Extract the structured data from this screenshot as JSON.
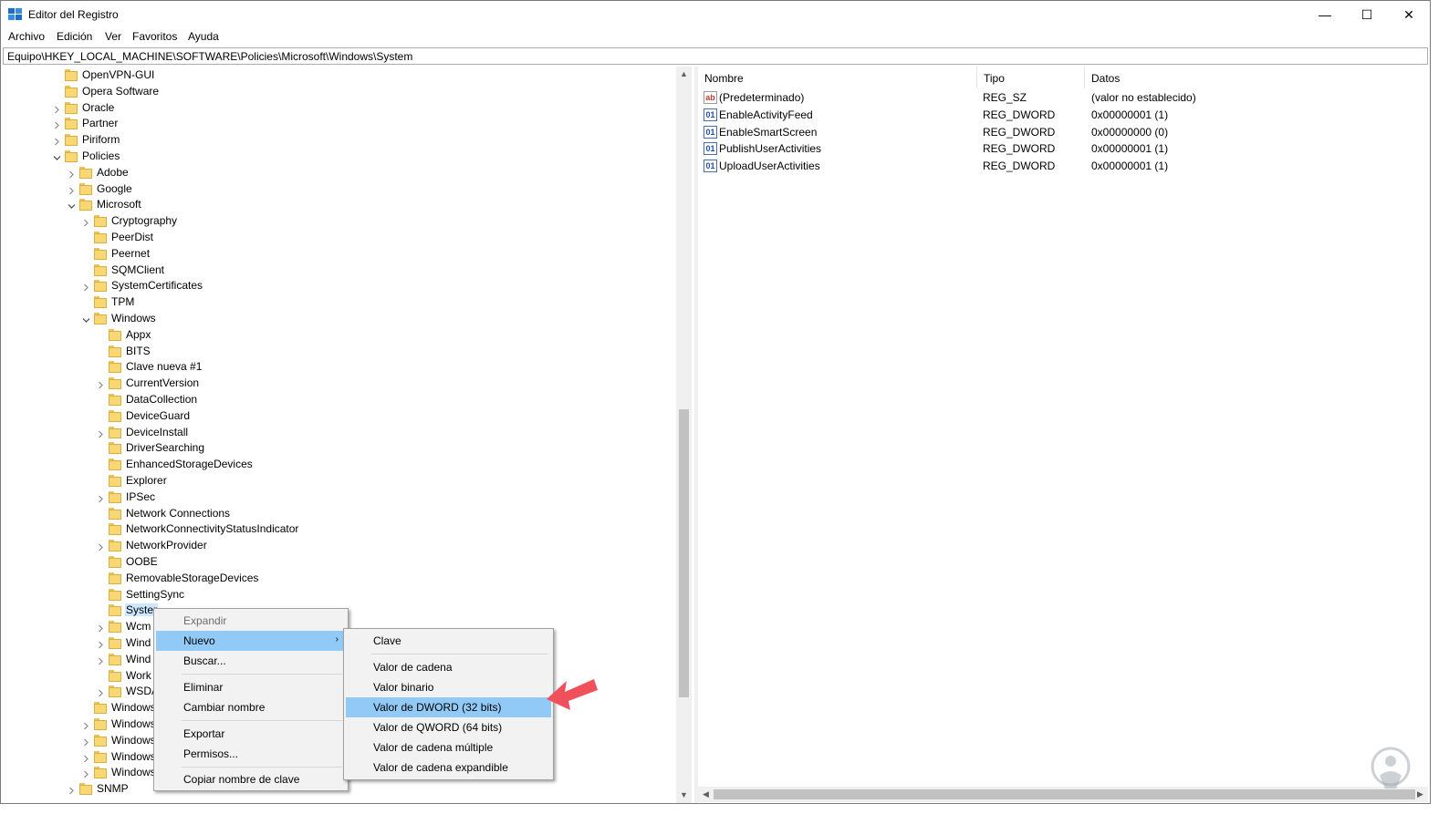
{
  "window": {
    "title": "Editor del Registro",
    "controls": {
      "minimize": "—",
      "maximize": "☐",
      "close": "✕"
    }
  },
  "menubar": [
    "Archivo",
    "Edición",
    "Ver",
    "Favoritos",
    "Ayuda"
  ],
  "address": "Equipo\\HKEY_LOCAL_MACHINE\\SOFTWARE\\Policies\\Microsoft\\Windows\\System",
  "tree": [
    {
      "label": "OpenVPN-GUI",
      "depth": 0,
      "expander": "none"
    },
    {
      "label": "Opera Software",
      "depth": 0,
      "expander": "none"
    },
    {
      "label": "Oracle",
      "depth": 0,
      "expander": "collapsed"
    },
    {
      "label": "Partner",
      "depth": 0,
      "expander": "collapsed"
    },
    {
      "label": "Piriform",
      "depth": 0,
      "expander": "collapsed"
    },
    {
      "label": "Policies",
      "depth": 0,
      "expander": "expanded"
    },
    {
      "label": "Adobe",
      "depth": 1,
      "expander": "collapsed"
    },
    {
      "label": "Google",
      "depth": 1,
      "expander": "collapsed"
    },
    {
      "label": "Microsoft",
      "depth": 1,
      "expander": "expanded"
    },
    {
      "label": "Cryptography",
      "depth": 2,
      "expander": "collapsed"
    },
    {
      "label": "PeerDist",
      "depth": 2,
      "expander": "none"
    },
    {
      "label": "Peernet",
      "depth": 2,
      "expander": "none"
    },
    {
      "label": "SQMClient",
      "depth": 2,
      "expander": "none"
    },
    {
      "label": "SystemCertificates",
      "depth": 2,
      "expander": "collapsed"
    },
    {
      "label": "TPM",
      "depth": 2,
      "expander": "none"
    },
    {
      "label": "Windows",
      "depth": 2,
      "expander": "expanded"
    },
    {
      "label": "Appx",
      "depth": 3,
      "expander": "none"
    },
    {
      "label": "BITS",
      "depth": 3,
      "expander": "none"
    },
    {
      "label": "Clave nueva #1",
      "depth": 3,
      "expander": "none"
    },
    {
      "label": "CurrentVersion",
      "depth": 3,
      "expander": "collapsed"
    },
    {
      "label": "DataCollection",
      "depth": 3,
      "expander": "none"
    },
    {
      "label": "DeviceGuard",
      "depth": 3,
      "expander": "none"
    },
    {
      "label": "DeviceInstall",
      "depth": 3,
      "expander": "collapsed"
    },
    {
      "label": "DriverSearching",
      "depth": 3,
      "expander": "none"
    },
    {
      "label": "EnhancedStorageDevices",
      "depth": 3,
      "expander": "none"
    },
    {
      "label": "Explorer",
      "depth": 3,
      "expander": "none"
    },
    {
      "label": "IPSec",
      "depth": 3,
      "expander": "collapsed"
    },
    {
      "label": "Network Connections",
      "depth": 3,
      "expander": "none"
    },
    {
      "label": "NetworkConnectivityStatusIndicator",
      "depth": 3,
      "expander": "none"
    },
    {
      "label": "NetworkProvider",
      "depth": 3,
      "expander": "collapsed"
    },
    {
      "label": "OOBE",
      "depth": 3,
      "expander": "none"
    },
    {
      "label": "RemovableStorageDevices",
      "depth": 3,
      "expander": "none"
    },
    {
      "label": "SettingSync",
      "depth": 3,
      "expander": "none"
    },
    {
      "label": "Syster",
      "depth": 3,
      "expander": "none",
      "selected": true
    },
    {
      "label": "Wcm",
      "depth": 3,
      "expander": "collapsed"
    },
    {
      "label": "Wind",
      "depth": 3,
      "expander": "collapsed"
    },
    {
      "label": "Wind",
      "depth": 3,
      "expander": "collapsed"
    },
    {
      "label": "Work",
      "depth": 3,
      "expander": "none"
    },
    {
      "label": "WSDA",
      "depth": 3,
      "expander": "collapsed"
    },
    {
      "label": "Windows",
      "depth": 2,
      "expander": "none"
    },
    {
      "label": "Windows",
      "depth": 2,
      "expander": "collapsed"
    },
    {
      "label": "Windows",
      "depth": 2,
      "expander": "collapsed"
    },
    {
      "label": "Windows",
      "depth": 2,
      "expander": "collapsed"
    },
    {
      "label": "Windows",
      "depth": 2,
      "expander": "collapsed"
    },
    {
      "label": "SNMP",
      "depth": 1,
      "expander": "collapsed"
    }
  ],
  "list": {
    "columns": [
      "Nombre",
      "Tipo",
      "Datos"
    ],
    "rows": [
      {
        "icon": "string-value-icon",
        "icon_text": "ab",
        "name": "(Predeterminado)",
        "type": "REG_SZ",
        "data": "(valor no establecido)"
      },
      {
        "icon": "binary-value-icon",
        "icon_text": "01",
        "name": "EnableActivityFeed",
        "type": "REG_DWORD",
        "data": "0x00000001 (1)"
      },
      {
        "icon": "binary-value-icon",
        "icon_text": "01",
        "name": "EnableSmartScreen",
        "type": "REG_DWORD",
        "data": "0x00000000 (0)"
      },
      {
        "icon": "binary-value-icon",
        "icon_text": "01",
        "name": "PublishUserActivities",
        "type": "REG_DWORD",
        "data": "0x00000001 (1)"
      },
      {
        "icon": "binary-value-icon",
        "icon_text": "01",
        "name": "UploadUserActivities",
        "type": "REG_DWORD",
        "data": "0x00000001 (1)"
      }
    ]
  },
  "context_menu": {
    "expand": "Expandir",
    "new": "Nuevo",
    "find": "Buscar...",
    "delete": "Eliminar",
    "rename": "Cambiar nombre",
    "export": "Exportar",
    "permissions": "Permisos...",
    "copy_key_name": "Copiar nombre de clave",
    "arrow": "›"
  },
  "submenu": {
    "key": "Clave",
    "string": "Valor de cadena",
    "binary": "Valor binario",
    "dword": "Valor de DWORD (32 bits)",
    "qword": "Valor de QWORD (64 bits)",
    "multi_string": "Valor de cadena múltiple",
    "expand_string": "Valor de cadena expandible"
  },
  "colors": {
    "highlight": "#91c9f7",
    "selection": "#cce8ff",
    "arrow": "#f0505a"
  }
}
